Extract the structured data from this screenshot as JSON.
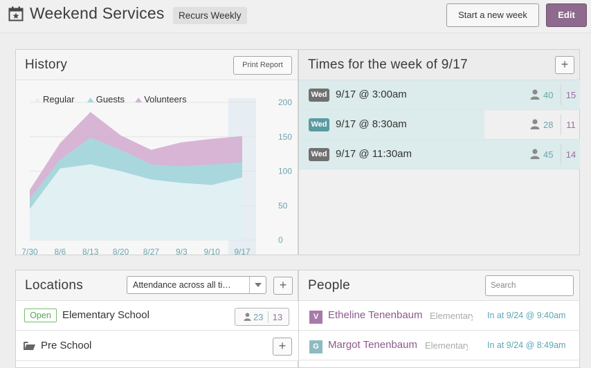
{
  "header": {
    "title": "Weekend Services",
    "recurrence_badge": "Recurs Weekly",
    "start_new_week_label": "Start a new week",
    "edit_label": "Edit"
  },
  "history": {
    "title": "History",
    "print_label": "Print Report"
  },
  "chart_data": {
    "type": "area",
    "stacked": true,
    "categories": [
      "7/30",
      "8/6",
      "8/13",
      "8/20",
      "8/27",
      "9/3",
      "9/10",
      "9/17"
    ],
    "series": [
      {
        "name": "Regular",
        "color": "#e4f1f3",
        "values": [
          45,
          104,
          110,
          100,
          88,
          83,
          80,
          91
        ]
      },
      {
        "name": "Guests",
        "color": "#a7d9de",
        "values": [
          15,
          13,
          39,
          31,
          22,
          24,
          30,
          22
        ]
      },
      {
        "name": "Volunteers",
        "color": "#d6b1d3",
        "values": [
          13,
          24,
          37,
          21,
          21,
          35,
          37,
          38
        ]
      }
    ],
    "y_ticks": [
      "200",
      "150",
      "100",
      "50",
      "0"
    ],
    "ylim": [
      0,
      200
    ],
    "legend_position": "top-left",
    "highlighted_category": "9/17",
    "grid": true
  },
  "times": {
    "title": "Times for the week of 9/17",
    "rows": [
      {
        "day": "Wed",
        "label": "9/17 @ 3:00am",
        "regular": "40",
        "volunteers": "15",
        "fill": 1.0
      },
      {
        "day": "Wed",
        "label": "9/17 @ 8:30am",
        "regular": "28",
        "volunteers": "11",
        "fill": 0.66
      },
      {
        "day": "Wed",
        "label": "9/17 @ 11:30am",
        "regular": "45",
        "volunteers": "14",
        "fill": 1.0
      }
    ]
  },
  "locations": {
    "title": "Locations",
    "select_value": "Attendance across all ti…",
    "rows": [
      {
        "status": "Open",
        "name": "Elementary School",
        "regular": "23",
        "volunteers": "13"
      },
      {
        "name": "Pre School"
      }
    ]
  },
  "people": {
    "title": "People",
    "search_placeholder": "Search",
    "rows": [
      {
        "initial": "V",
        "name": "Etheline Tenenbaum",
        "location": "Elementary School",
        "status": "In at 9/24 @ 9:40am",
        "avatar_color": "#a77aa8",
        "name_color": "#8b5a8e"
      },
      {
        "initial": "G",
        "name": "Margot Tenenbaum",
        "location": "Elementary School",
        "status": "In at 9/24 @ 8:49am",
        "avatar_color": "#8cbcc2",
        "name_color": "#8b5a8e"
      }
    ]
  },
  "colors": {
    "accent": "#8d6a8e",
    "teal": "#6aa5b0",
    "purple": "#a06aa5"
  }
}
